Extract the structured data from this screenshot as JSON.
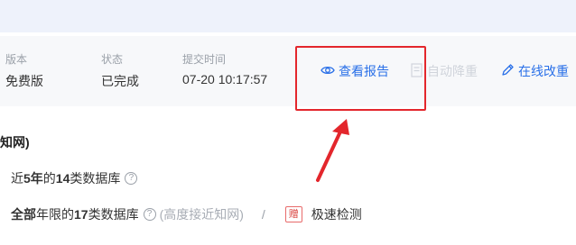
{
  "header": {
    "version_label": "版本",
    "version_value": "免费版",
    "status_label": "状态",
    "status_value": "已完成",
    "submit_time_label": "提交时间",
    "submit_time_value": "07-20 10:17:57"
  },
  "actions": {
    "view_report": "查看报告",
    "auto_dedup": "自动降重",
    "online_rewrite": "在线改重"
  },
  "db_section": {
    "title": "知网)",
    "row1": {
      "prefix": "近",
      "years": "5年",
      "mid": "的",
      "count": "14",
      "suffix": "类数据库",
      "help": "?"
    },
    "row2": {
      "all_years": "全部",
      "mid1": "年限的",
      "count": "17",
      "suffix": "类数据库",
      "help": "?",
      "note": "(高度接近知网)",
      "sep": "/",
      "gift_badge": "赠",
      "fast_check": "极速检测"
    }
  },
  "colors": {
    "link_blue": "#2a70e8",
    "highlight_red": "#e3262c",
    "disabled_gray": "#d0d4db"
  }
}
